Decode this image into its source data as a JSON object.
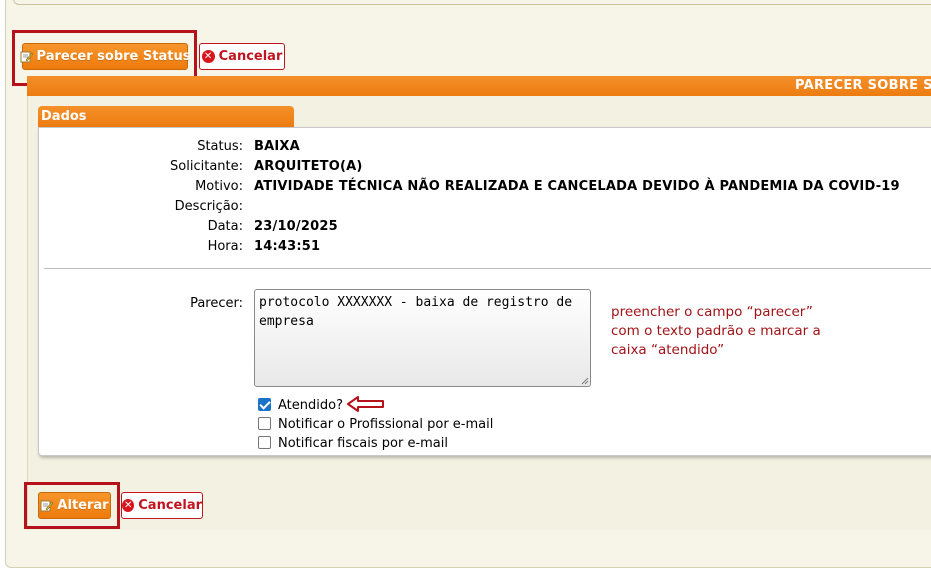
{
  "top_actions": {
    "parecer_label": "Parecer sobre Status",
    "cancel_label": "Cancelar"
  },
  "section": {
    "title": "PARECER SOBRE S"
  },
  "dados": {
    "tab_label": "Dados",
    "fields": {
      "status_label": "Status:",
      "status_value": "BAIXA",
      "solicitante_label": "Solicitante:",
      "solicitante_value": "ARQUITETO(A)",
      "motivo_label": "Motivo:",
      "motivo_value": "ATIVIDADE TÉCNICA NÃO REALIZADA E CANCELADA DEVIDO À PANDEMIA DA COVID-19",
      "descricao_label": "Descrição:",
      "descricao_value": "",
      "data_label": "Data:",
      "data_value": "23/10/2025",
      "hora_label": "Hora:",
      "hora_value": "14:43:51"
    },
    "parecer_label": "Parecer:",
    "parecer_value": "protocolo XXXXXXX - baixa de registro de empresa",
    "annotation": "preencher o campo “parecer” com o texto padrão e marcar a caixa “atendido”",
    "checkboxes": [
      {
        "label": "Atendido?",
        "checked": true
      },
      {
        "label": "Notificar o Profissional por e-mail",
        "checked": false
      },
      {
        "label": "Notificar fiscais por e-mail",
        "checked": false
      }
    ]
  },
  "bottom_actions": {
    "alterar_label": "Alterar",
    "cancel_label": "Cancelar"
  },
  "colors": {
    "accent": "#f08418",
    "highlight": "#b5121b",
    "annotation_text": "#a01318",
    "checkbox": "#1a73c9"
  }
}
